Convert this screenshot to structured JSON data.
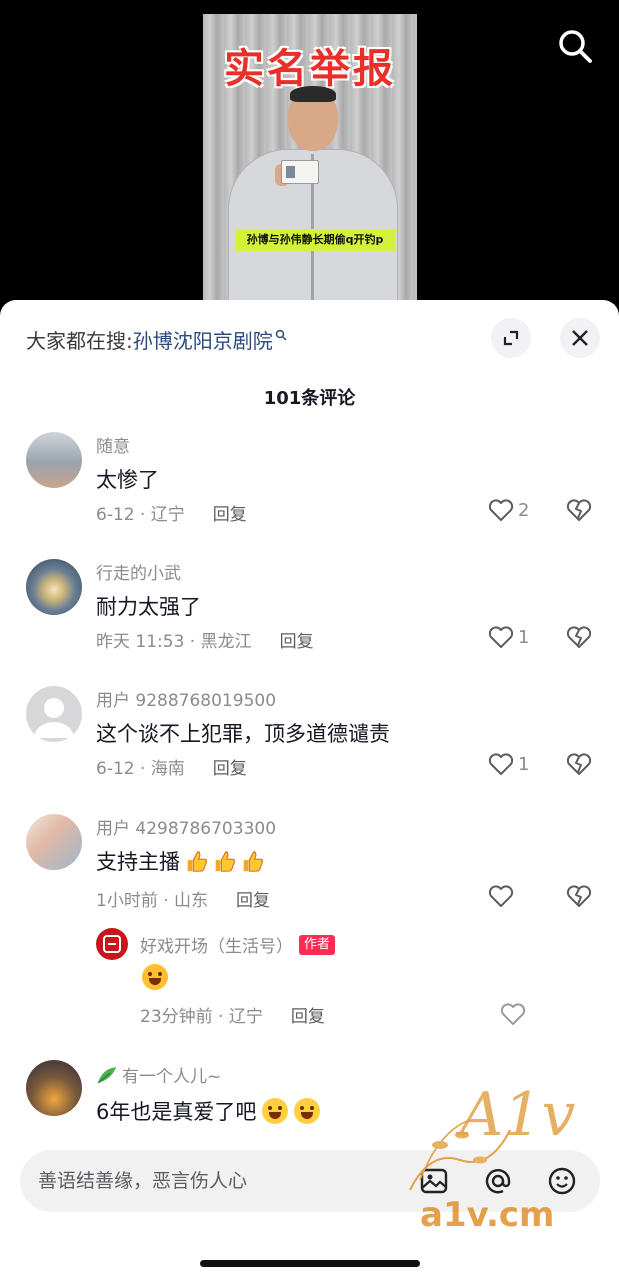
{
  "video": {
    "title": "实名举报",
    "caption": "孙博与孙伟静长期偷q开钓p"
  },
  "sheet": {
    "search_prefix": "大家都在搜:",
    "search_keyword": "孙博沈阳京剧院",
    "comment_count": "101条评论"
  },
  "comments": [
    {
      "user": "随意",
      "text": "太惨了",
      "meta": "6-12 · 辽宁",
      "reply": "回复",
      "likes": "2"
    },
    {
      "user": "行走的小武",
      "text": "耐力太强了",
      "meta": "昨天 11:53 · 黑龙江",
      "reply": "回复",
      "likes": "1"
    },
    {
      "user": "用户 9288768019500",
      "text": "这个谈不上犯罪，顶多道德谴责",
      "meta": "6-12 · 海南",
      "reply": "回复",
      "likes": "1"
    },
    {
      "user": "用户 4298786703300",
      "text": "支持主播",
      "meta": "1小时前 · 山东",
      "reply": "回复",
      "likes": ""
    }
  ],
  "sub_reply": {
    "user": "好戏开场（生活号）",
    "badge": "作者",
    "meta": "23分钟前 · 辽宁",
    "reply": "回复"
  },
  "last_comment": {
    "user": "有一个人儿~",
    "text": "6年也是真爱了吧"
  },
  "input": {
    "placeholder": "善语结善缘，恶言伤人心"
  },
  "watermark": {
    "script": "A1v",
    "url": "a1v.cm"
  },
  "colors": {
    "accent_red": "#fe2c55",
    "link_blue": "#2c4a7c",
    "caption_yellow": "#d4f23a"
  }
}
